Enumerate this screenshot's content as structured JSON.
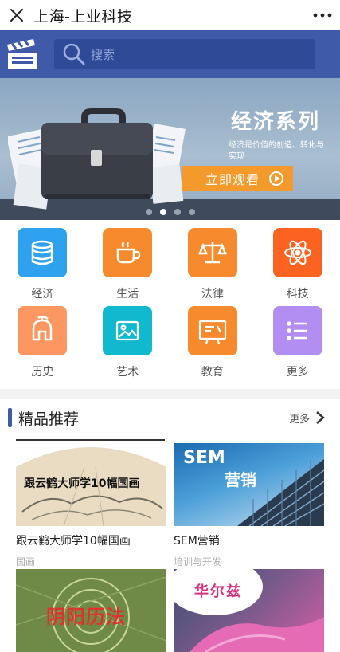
{
  "titlebar": {
    "title": "上海-上业科技",
    "close_icon": "close-icon",
    "more_icon": "more-dots-icon"
  },
  "header": {
    "search_placeholder": "搜索",
    "search_icon": "search-icon",
    "logo_icon": "clapperboard-logo-icon"
  },
  "banner": {
    "title": "经济系列",
    "subtitle": "经济是价值的创造、转化与实现",
    "cta_label": "立即观看",
    "slides": 4,
    "active_slide": 2
  },
  "categories": [
    {
      "label": "经济",
      "icon": "coins-icon",
      "color": "#2ea2ef"
    },
    {
      "label": "生活",
      "icon": "coffee-cup-icon",
      "color": "#f68a2d"
    },
    {
      "label": "法律",
      "icon": "scales-icon",
      "color": "#f68a2d"
    },
    {
      "label": "科技",
      "icon": "atom-icon",
      "color": "#fc6321"
    },
    {
      "label": "历史",
      "icon": "helmet-icon",
      "color": "#fc9761"
    },
    {
      "label": "艺术",
      "icon": "picture-icon",
      "color": "#11b9cf"
    },
    {
      "label": "教育",
      "icon": "chalkboard-icon",
      "color": "#f68a2d"
    },
    {
      "label": "更多",
      "icon": "list-icon",
      "color": "#b38ef2"
    }
  ],
  "section": {
    "title": "精品推荐",
    "more_label": "更多"
  },
  "cards": [
    {
      "title": "跟云鹤大师学10幅国画",
      "tag": "国画",
      "thumb_text": "跟云鹤大师学10幅国画"
    },
    {
      "title": "SEM营销",
      "tag": "培训与开发",
      "thumb_text_en": "SEM",
      "thumb_text_cn": "营销"
    },
    {
      "title": "",
      "tag": "",
      "thumb_text": "阴阳历法"
    },
    {
      "title": "",
      "tag": "",
      "thumb_text": "华尔兹"
    }
  ]
}
